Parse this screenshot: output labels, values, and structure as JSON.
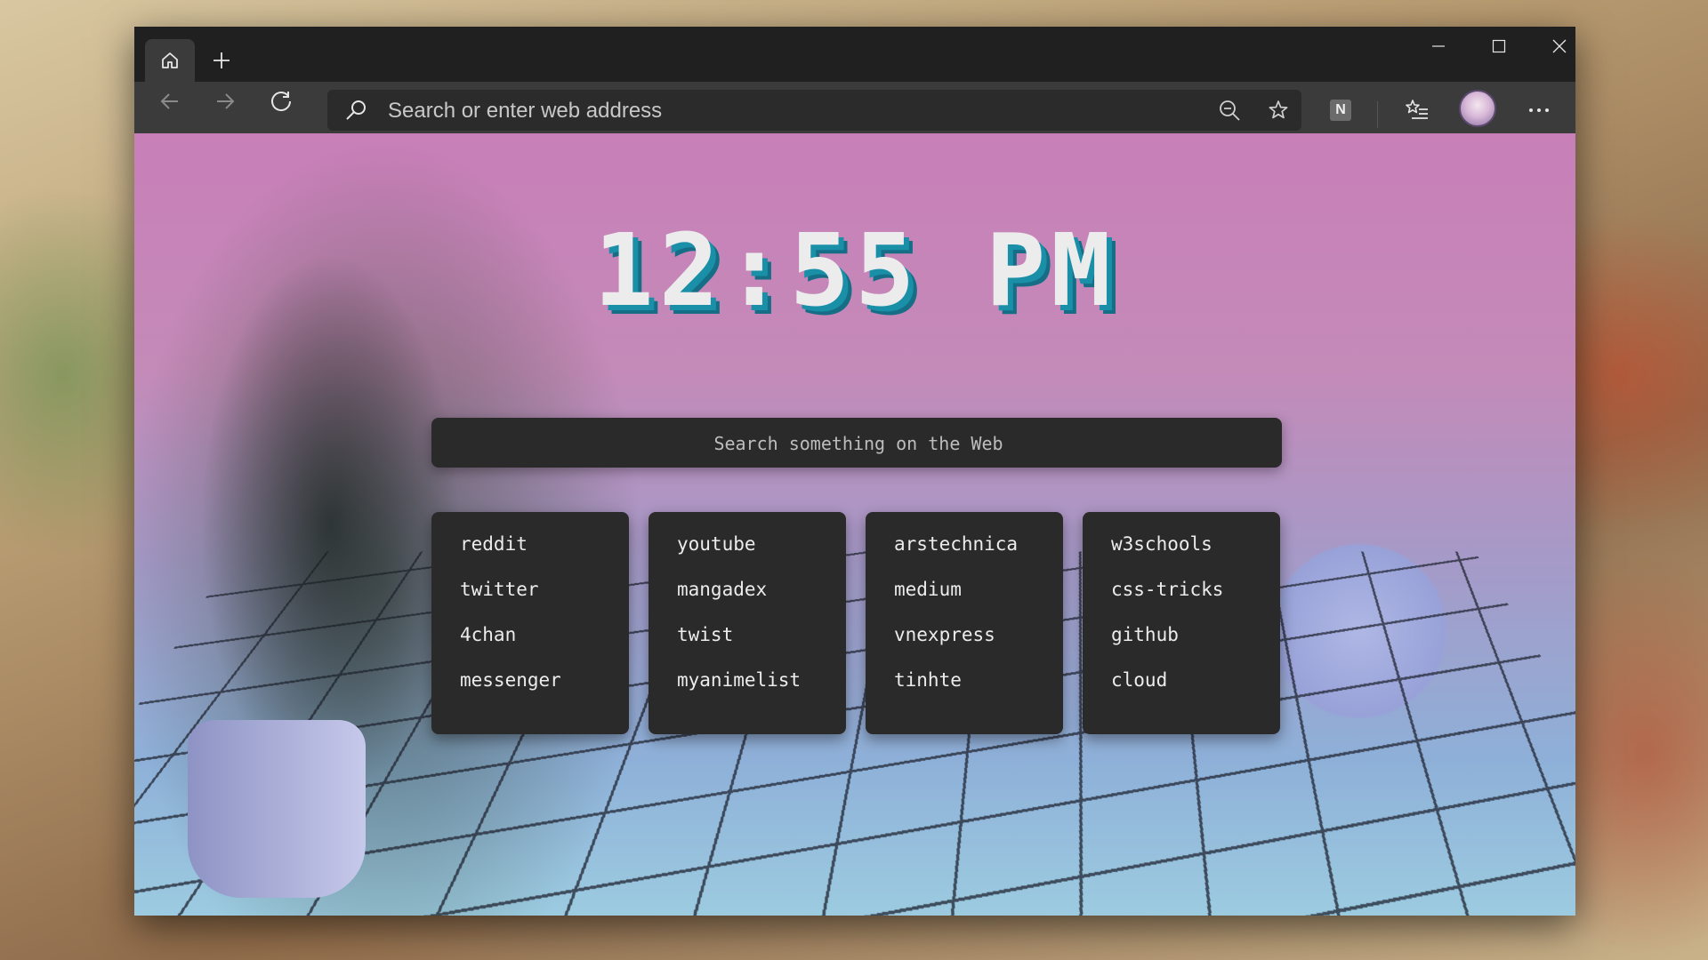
{
  "browser": {
    "address_placeholder": "Search or enter web address",
    "extension_label": "N"
  },
  "page": {
    "clock": "12:55 PM",
    "search_placeholder": "Search something on the Web",
    "link_groups": [
      {
        "links": [
          "reddit",
          "twitter",
          "4chan",
          "messenger"
        ]
      },
      {
        "links": [
          "youtube",
          "mangadex",
          "twist",
          "myanimelist"
        ]
      },
      {
        "links": [
          "arstechnica",
          "medium",
          "vnexpress",
          "tinhte"
        ]
      },
      {
        "links": [
          "w3schools",
          "css-tricks",
          "github",
          "cloud"
        ]
      }
    ]
  },
  "colors": {
    "clock_shadow": "#1a8fa8",
    "window_chrome": "#202020",
    "toolbar": "#3b3b3b",
    "card": "#2a2a2a"
  }
}
